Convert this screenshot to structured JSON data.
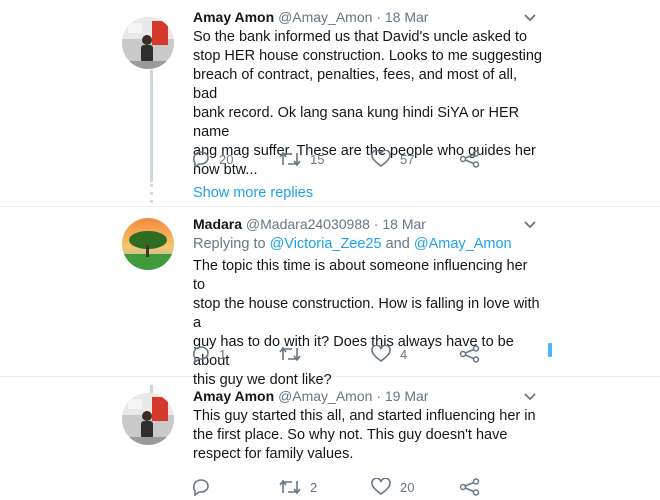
{
  "colors": {
    "accent": "#1da1f2",
    "muted": "#657786",
    "text": "#14171a",
    "line": "#ccd6dd"
  },
  "tweets": [
    {
      "name": "Amay Amon",
      "handle": "@Amay_Amon",
      "sep": "·",
      "time": "18 Mar",
      "lines": [
        "So the bank informed us that David's uncle asked to",
        "stop HER house construction. Looks to me suggesting",
        "breach of contract, penalties, fees, and most of all, bad",
        "bank record. Ok lang sana kung hindi SiYA or HER name",
        "ang mag suffer. These are the people who guides her",
        "now btw..."
      ],
      "replies": "20",
      "retweets": "15",
      "likes": "57"
    },
    {
      "name": "Madara",
      "handle": "@Madara24030988",
      "sep": "·",
      "time": "18 Mar",
      "reply_prefix": "Replying to",
      "reply_user1": "@Victoria_Zee25",
      "reply_and": "and",
      "reply_user2": "@Amay_Amon",
      "lines": [
        "The topic this time is about someone influencing her to",
        "stop the house construction. How is falling in love with a",
        "guy has to do with it? Does this always have to be about",
        "this guy we dont like?"
      ],
      "replies": "1",
      "retweets": "",
      "likes": "4"
    },
    {
      "name": "Amay Amon",
      "handle": "@Amay_Amon",
      "sep": "·",
      "time": "19 Mar",
      "lines": [
        "This guy started this all, and started influencing her in",
        "the first place. So why not. This guy doesn't have",
        "respect for family values."
      ],
      "replies": "",
      "retweets": "2",
      "likes": "20"
    }
  ],
  "show_more": "Show more replies",
  "icons": [
    "reply-icon",
    "retweet-icon",
    "like-icon",
    "share-icon",
    "chevron-down-icon"
  ]
}
